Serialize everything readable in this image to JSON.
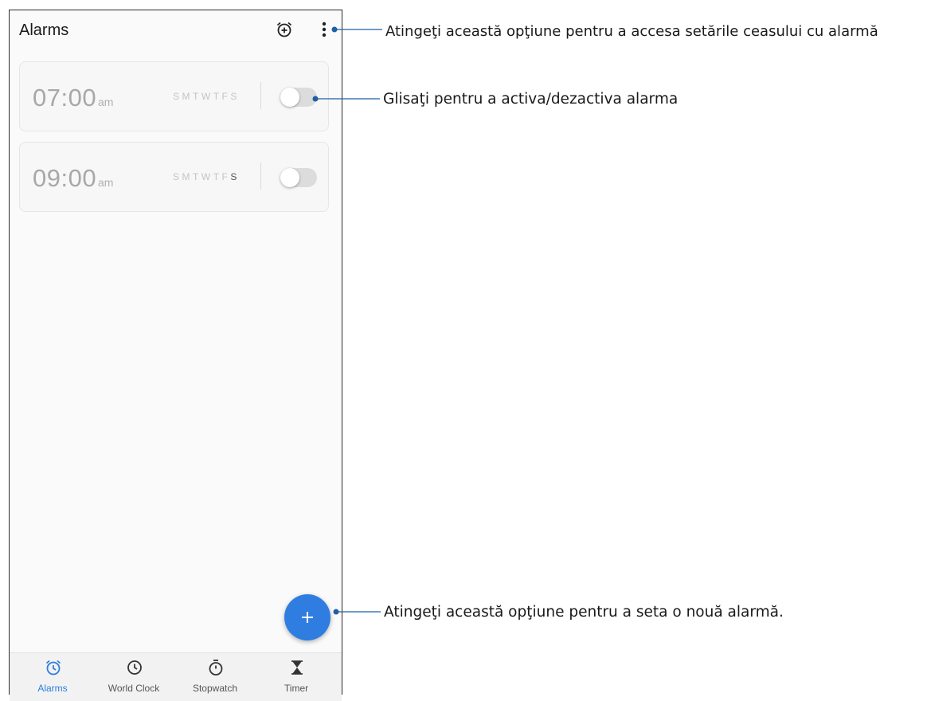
{
  "app_bar": {
    "title": "Alarms",
    "add_alarm_icon": "alarm-add-icon",
    "more_icon": "more-vert-icon"
  },
  "alarms": [
    {
      "time": "07:00",
      "ampm": "am",
      "days": [
        "S",
        "M",
        "T",
        "W",
        "T",
        "F",
        "S"
      ],
      "active_days": [],
      "enabled": false
    },
    {
      "time": "09:00",
      "ampm": "am",
      "days": [
        "S",
        "M",
        "T",
        "W",
        "T",
        "F",
        "S"
      ],
      "active_days": [
        6
      ],
      "enabled": false
    }
  ],
  "fab": {
    "icon": "plus-icon"
  },
  "bottom_nav": [
    {
      "label": "Alarms",
      "icon": "alarm-icon",
      "active": true
    },
    {
      "label": "World Clock",
      "icon": "clock-icon",
      "active": false
    },
    {
      "label": "Stopwatch",
      "icon": "stopwatch-icon",
      "active": false
    },
    {
      "label": "Timer",
      "icon": "hourglass-icon",
      "active": false
    }
  ],
  "callouts": [
    "Atingeţi această opţiune pentru a accesa setările ceasului cu alarmă",
    "Glisaţi pentru a activa/dezactiva alarma",
    "Atingeţi această opţiune pentru a seta o nouă alarmă."
  ],
  "colors": {
    "accent": "#2f7de1",
    "callout_line": "#1f5fa6",
    "toggle_off": "#dcdcdc"
  }
}
